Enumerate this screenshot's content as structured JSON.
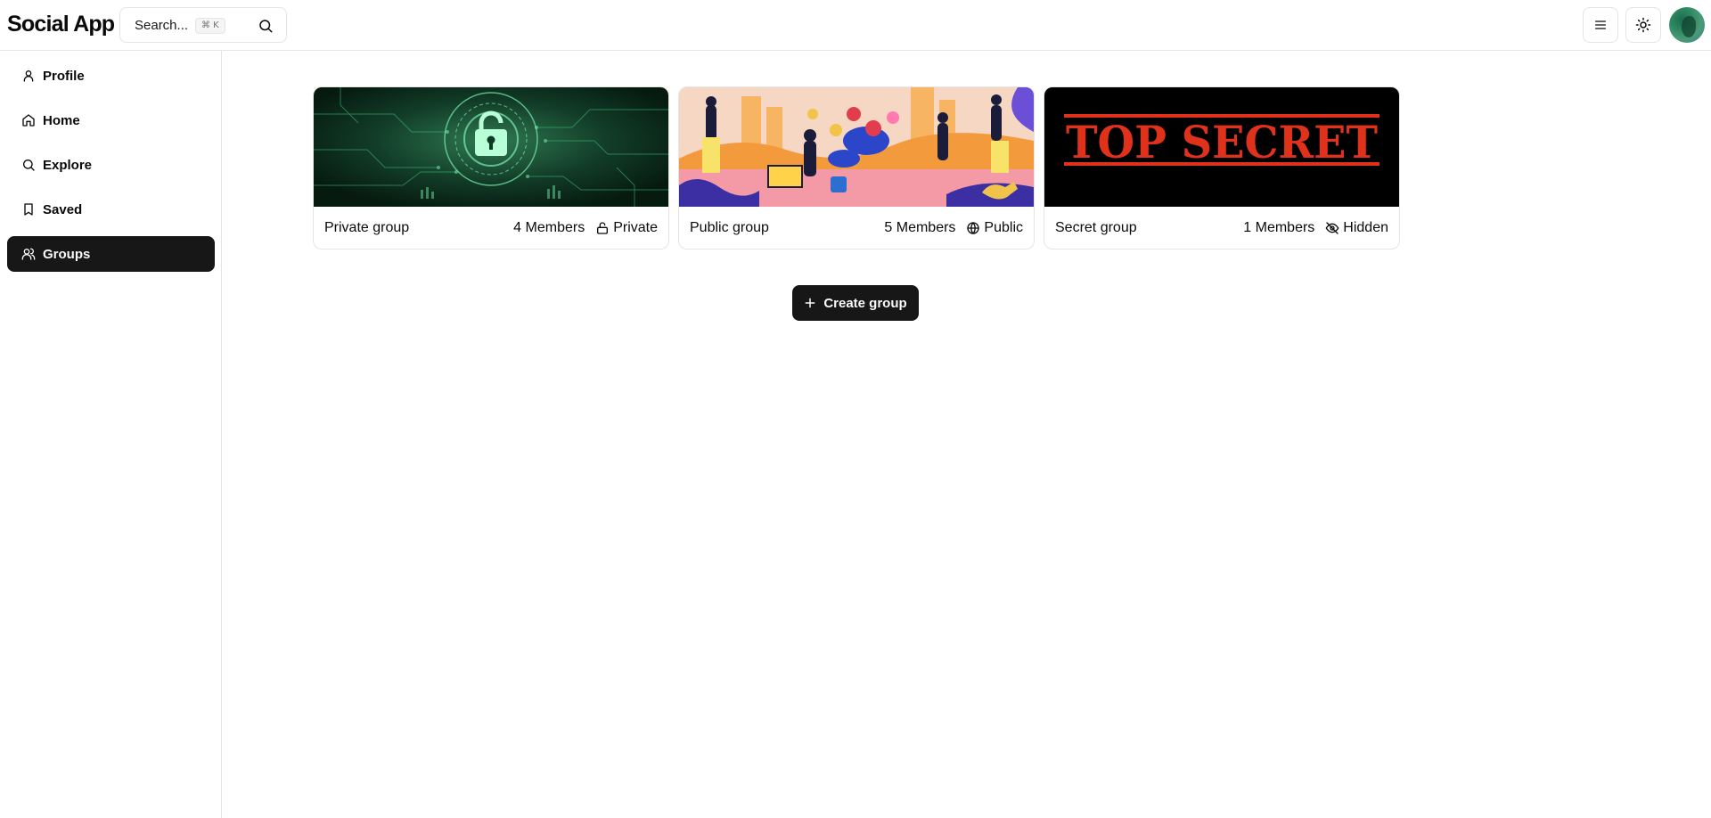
{
  "header": {
    "app_title": "Social App",
    "search": {
      "placeholder": "Search...",
      "shortcut": "⌘ K"
    }
  },
  "sidebar": {
    "items": [
      {
        "label": "Profile",
        "icon": "user-icon",
        "active": false
      },
      {
        "label": "Home",
        "icon": "home-icon",
        "active": false
      },
      {
        "label": "Explore",
        "icon": "search-icon",
        "active": false
      },
      {
        "label": "Saved",
        "icon": "bookmark-icon",
        "active": false
      },
      {
        "label": "Groups",
        "icon": "users-icon",
        "active": true
      }
    ]
  },
  "groups": [
    {
      "name": "Private group",
      "members": "4 Members",
      "visibility": "Private",
      "visibility_icon": "lock-icon",
      "image": "cyber-lock-banner"
    },
    {
      "name": "Public group",
      "members": "5 Members",
      "visibility": "Public",
      "visibility_icon": "globe-icon",
      "image": "people-gardening-illustration"
    },
    {
      "name": "Secret group",
      "members": "1 Members",
      "visibility": "Hidden",
      "visibility_icon": "eye-off-icon",
      "image": "top-secret-stamp",
      "image_text": "TOP SECRET"
    }
  ],
  "actions": {
    "create_group_label": "Create group"
  },
  "colors": {
    "primary": "#171717",
    "border": "#e5e5e5",
    "background": "#ffffff",
    "stamp_red": "#e0321b"
  }
}
